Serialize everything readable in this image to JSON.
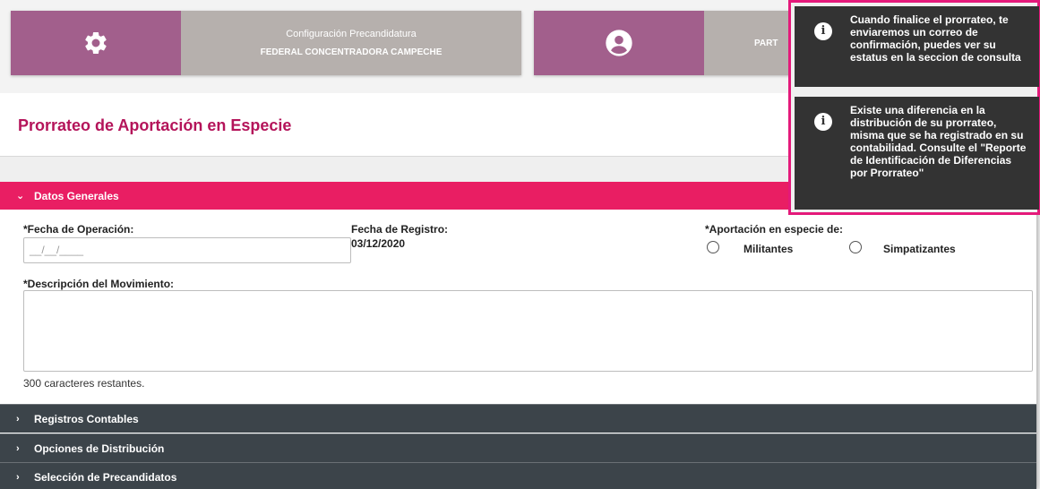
{
  "header": {
    "card1_subtitle": "Configuración Precandidatura",
    "card1_title": "FEDERAL CONCENTRADORA CAMPECHE",
    "card2_title": "PART"
  },
  "page": {
    "title": "Prorrateo de Aportación en Especie"
  },
  "sections": {
    "datos_generales": "Datos Generales",
    "registros_contables": "Registros Contables",
    "opciones_distribucion": "Opciones de Distribución",
    "seleccion_precandidatos": "Selección de Precandidatos"
  },
  "form": {
    "fecha_operacion_label": "*Fecha de Operación:",
    "fecha_operacion_placeholder": "__/__/____",
    "fecha_registro_label": "Fecha de Registro:",
    "fecha_registro_value": "03/12/2020",
    "aportacion_label": "*Aportación en especie de:",
    "option_militantes": "Militantes",
    "option_simpatizantes": "Simpatizantes",
    "descripcion_label": "*Descripción del Movimiento:",
    "chars_remaining": "300 caracteres restantes."
  },
  "toasts": {
    "toast1": "Cuando finalice el prorrateo, te enviaremos un correo de confirmación, puedes ver su estatus en la seccion de consulta",
    "toast2": "Existe una diferencia en la distribución de su prorrateo, misma que se ha registrado en su contabilidad. Consulte el \"Reporte de Identificación de Diferencias por Prorrateo\""
  },
  "colors": {
    "accent_pink": "#e91e63",
    "title_magenta": "#b4145a",
    "card_purple": "#a25f8c",
    "card_gray": "#b6b0ad",
    "section_dark": "#3c444a",
    "toast_bg": "#333333"
  }
}
